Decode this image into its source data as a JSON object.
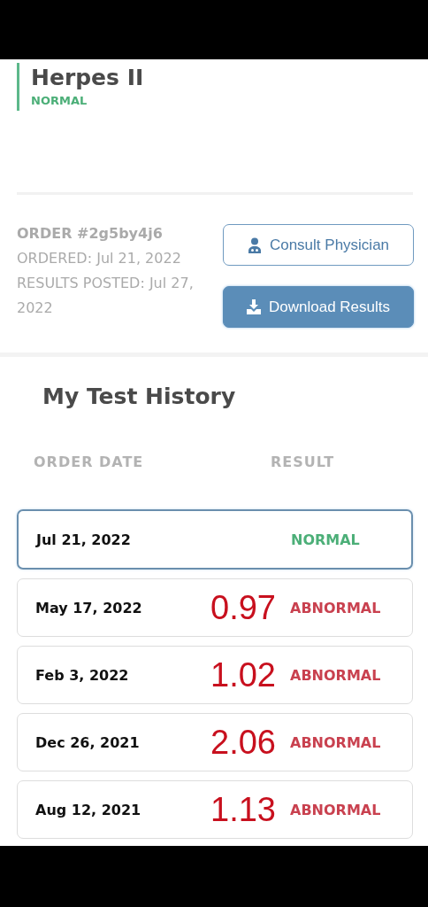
{
  "test": {
    "name": "Herpes II",
    "kind": "normal",
    "status_label": "NORMAL"
  },
  "order": {
    "number": "ORDER #2g5by4j6",
    "ordered": "ORDERED: Jul 21, 2022",
    "posted": "RESULTS POSTED: Jul 27, 2022"
  },
  "buttons": [
    {
      "kind": "outline",
      "label": "Consult Physician"
    },
    {
      "kind": "filled",
      "label": "Download Results"
    }
  ],
  "history": {
    "title": "My Test History",
    "columns": [
      "ORDER DATE",
      "RESULT"
    ],
    "rows": [
      {
        "date": "Jul 21, 2022",
        "kind": "normal",
        "result": "NORMAL",
        "selected": true
      },
      {
        "date": "May 17, 2022",
        "value": "0.97",
        "kind": "abnormal",
        "result": "ABNORMAL",
        "selected": false
      },
      {
        "date": "Feb 3, 2022",
        "value": "1.02",
        "kind": "abnormal",
        "result": "ABNORMAL",
        "selected": false
      },
      {
        "date": "Dec 26, 2021",
        "value": "2.06",
        "kind": "abnormal",
        "result": "ABNORMAL",
        "selected": false
      },
      {
        "date": "Aug 12, 2021",
        "value": "1.13",
        "kind": "abnormal",
        "result": "ABNORMAL",
        "selected": false
      }
    ]
  }
}
